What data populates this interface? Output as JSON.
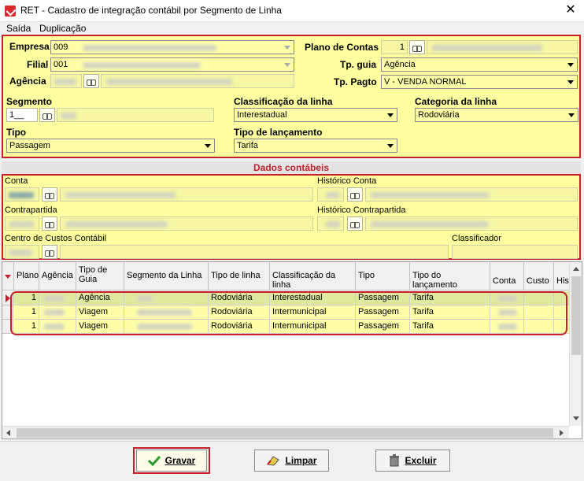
{
  "window": {
    "title": "RET - Cadastro de integração contábil por Segmento de Linha",
    "close": "✕"
  },
  "menu": {
    "items": [
      "Saída",
      "Duplicação"
    ]
  },
  "header": {
    "empresa_label": "Empresa",
    "empresa_value": "009",
    "filial_label": "Filial",
    "filial_value": "001",
    "agencia_label": "Agência",
    "plano_label": "Plano de Contas",
    "plano_value": "1",
    "tp_guia_label": "Tp. guia",
    "tp_guia_value": "Agência",
    "tp_pagto_label": "Tp. Pagto",
    "tp_pagto_value": "V - VENDA NORMAL",
    "segmento_label": "Segmento",
    "segmento_value": "1__",
    "classificacao_label": "Classificação da linha",
    "classificacao_value": "Interestadual",
    "categoria_label": "Categoria da linha",
    "categoria_value": "Rodoviária",
    "tipo_label": "Tipo",
    "tipo_value": "Passagem",
    "tipo_lanc_label": "Tipo de lançamento",
    "tipo_lanc_value": "Tarifa"
  },
  "contabeis": {
    "section_title": "Dados contábeis",
    "conta_label": "Conta",
    "historico_conta_label": "Histórico Conta",
    "contrapartida_label": "Contrapartida",
    "historico_contrapartida_label": "Histórico Contrapartida",
    "centro_custos_label": "Centro de Custos Contábil",
    "classificador_label": "Classificador"
  },
  "grid": {
    "columns": [
      "Plano",
      "Agência",
      "Tipo de Guia",
      "Segmento da Linha",
      "Tipo de linha",
      "Classificação da linha",
      "Tipo",
      "Tipo do lançamento",
      "Conta",
      "Custo",
      "His"
    ],
    "rows": [
      {
        "plano": "1",
        "tipo_guia": "Agência",
        "tipo_linha": "Rodoviária",
        "classificacao": "Interestadual",
        "tipo": "Passagem",
        "lancamento": "Tarifa"
      },
      {
        "plano": "1",
        "tipo_guia": "Viagem",
        "tipo_linha": "Rodoviária",
        "classificacao": "Intermunicipal",
        "tipo": "Passagem",
        "lancamento": "Tarifa"
      },
      {
        "plano": "1",
        "tipo_guia": "Viagem",
        "tipo_linha": "Rodoviária",
        "classificacao": "Intermunicipal",
        "tipo": "Passagem",
        "lancamento": "Tarifa"
      }
    ]
  },
  "buttons": {
    "gravar": "Gravar",
    "limpar": "Limpar",
    "excluir": "Excluir"
  },
  "colors": {
    "panel_bg": "#ffffa0",
    "highlight_border": "#c8202b",
    "section_title": "#c0202b"
  }
}
